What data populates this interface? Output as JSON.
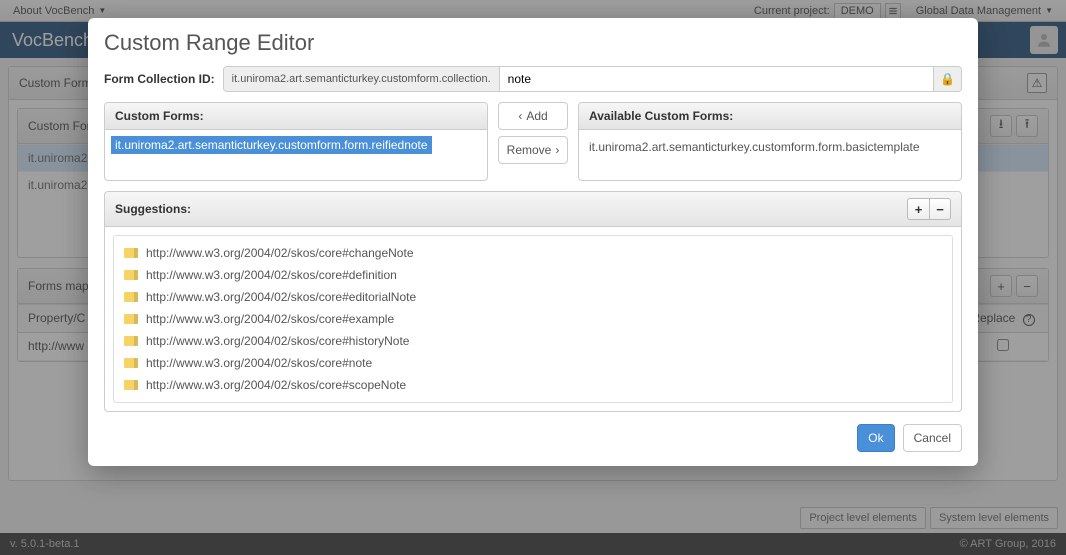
{
  "topbar": {
    "about": "About VocBench",
    "current_project_label": "Current project:",
    "current_project_value": "DEMO",
    "global_data": "Global Data Management"
  },
  "brand": {
    "name": "VocBench"
  },
  "page": {
    "outer_title": "Custom Form",
    "forms_panel_title": "Custom Forms",
    "forms_items": [
      "it.uniroma2.",
      "it.uniroma2."
    ],
    "map_panel_title": "Forms map",
    "map_col_prop": "Property/C",
    "map_col_replace": "Replace",
    "map_row_prop": "http://www"
  },
  "filters": {
    "project": "Project level elements",
    "system": "System level elements"
  },
  "bottom": {
    "version": "v. 5.0.1-beta.1",
    "copyright": "© ART Group, 2016"
  },
  "modal": {
    "title": "Custom Range Editor",
    "collection_label": "Form Collection ID:",
    "collection_addon": "it.uniroma2.art.semanticturkey.customform.collection.",
    "collection_value": "note",
    "custom_forms_title": "Custom Forms:",
    "custom_forms_item": "it.uniroma2.art.semanticturkey.customform.form.reifiednote",
    "add_label": "Add",
    "remove_label": "Remove",
    "available_title": "Available Custom Forms:",
    "available_item": "it.uniroma2.art.semanticturkey.customform.form.basictemplate",
    "suggestions_title": "Suggestions:",
    "suggestions": [
      "http://www.w3.org/2004/02/skos/core#changeNote",
      "http://www.w3.org/2004/02/skos/core#definition",
      "http://www.w3.org/2004/02/skos/core#editorialNote",
      "http://www.w3.org/2004/02/skos/core#example",
      "http://www.w3.org/2004/02/skos/core#historyNote",
      "http://www.w3.org/2004/02/skos/core#note",
      "http://www.w3.org/2004/02/skos/core#scopeNote"
    ],
    "ok": "Ok",
    "cancel": "Cancel"
  }
}
